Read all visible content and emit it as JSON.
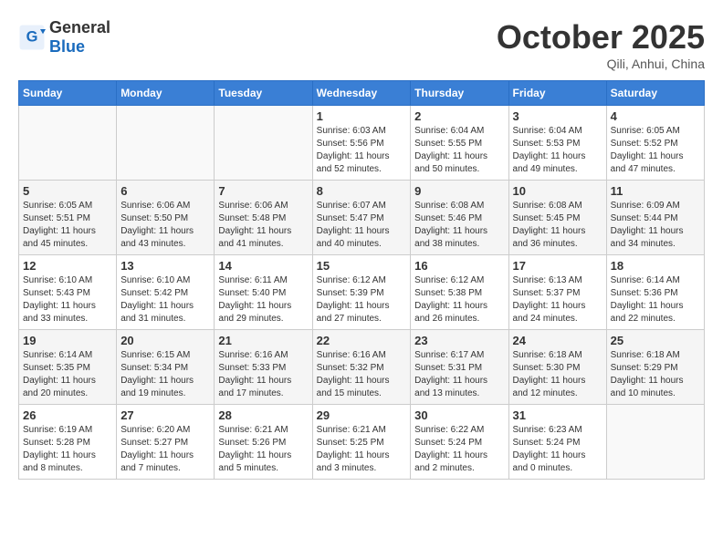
{
  "logo": {
    "general": "General",
    "blue": "Blue"
  },
  "header": {
    "month": "October 2025",
    "location": "Qili, Anhui, China"
  },
  "weekdays": [
    "Sunday",
    "Monday",
    "Tuesday",
    "Wednesday",
    "Thursday",
    "Friday",
    "Saturday"
  ],
  "weeks": [
    [
      {
        "day": "",
        "sunrise": "",
        "sunset": "",
        "daylight": ""
      },
      {
        "day": "",
        "sunrise": "",
        "sunset": "",
        "daylight": ""
      },
      {
        "day": "",
        "sunrise": "",
        "sunset": "",
        "daylight": ""
      },
      {
        "day": "1",
        "sunrise": "Sunrise: 6:03 AM",
        "sunset": "Sunset: 5:56 PM",
        "daylight": "Daylight: 11 hours and 52 minutes."
      },
      {
        "day": "2",
        "sunrise": "Sunrise: 6:04 AM",
        "sunset": "Sunset: 5:55 PM",
        "daylight": "Daylight: 11 hours and 50 minutes."
      },
      {
        "day": "3",
        "sunrise": "Sunrise: 6:04 AM",
        "sunset": "Sunset: 5:53 PM",
        "daylight": "Daylight: 11 hours and 49 minutes."
      },
      {
        "day": "4",
        "sunrise": "Sunrise: 6:05 AM",
        "sunset": "Sunset: 5:52 PM",
        "daylight": "Daylight: 11 hours and 47 minutes."
      }
    ],
    [
      {
        "day": "5",
        "sunrise": "Sunrise: 6:05 AM",
        "sunset": "Sunset: 5:51 PM",
        "daylight": "Daylight: 11 hours and 45 minutes."
      },
      {
        "day": "6",
        "sunrise": "Sunrise: 6:06 AM",
        "sunset": "Sunset: 5:50 PM",
        "daylight": "Daylight: 11 hours and 43 minutes."
      },
      {
        "day": "7",
        "sunrise": "Sunrise: 6:06 AM",
        "sunset": "Sunset: 5:48 PM",
        "daylight": "Daylight: 11 hours and 41 minutes."
      },
      {
        "day": "8",
        "sunrise": "Sunrise: 6:07 AM",
        "sunset": "Sunset: 5:47 PM",
        "daylight": "Daylight: 11 hours and 40 minutes."
      },
      {
        "day": "9",
        "sunrise": "Sunrise: 6:08 AM",
        "sunset": "Sunset: 5:46 PM",
        "daylight": "Daylight: 11 hours and 38 minutes."
      },
      {
        "day": "10",
        "sunrise": "Sunrise: 6:08 AM",
        "sunset": "Sunset: 5:45 PM",
        "daylight": "Daylight: 11 hours and 36 minutes."
      },
      {
        "day": "11",
        "sunrise": "Sunrise: 6:09 AM",
        "sunset": "Sunset: 5:44 PM",
        "daylight": "Daylight: 11 hours and 34 minutes."
      }
    ],
    [
      {
        "day": "12",
        "sunrise": "Sunrise: 6:10 AM",
        "sunset": "Sunset: 5:43 PM",
        "daylight": "Daylight: 11 hours and 33 minutes."
      },
      {
        "day": "13",
        "sunrise": "Sunrise: 6:10 AM",
        "sunset": "Sunset: 5:42 PM",
        "daylight": "Daylight: 11 hours and 31 minutes."
      },
      {
        "day": "14",
        "sunrise": "Sunrise: 6:11 AM",
        "sunset": "Sunset: 5:40 PM",
        "daylight": "Daylight: 11 hours and 29 minutes."
      },
      {
        "day": "15",
        "sunrise": "Sunrise: 6:12 AM",
        "sunset": "Sunset: 5:39 PM",
        "daylight": "Daylight: 11 hours and 27 minutes."
      },
      {
        "day": "16",
        "sunrise": "Sunrise: 6:12 AM",
        "sunset": "Sunset: 5:38 PM",
        "daylight": "Daylight: 11 hours and 26 minutes."
      },
      {
        "day": "17",
        "sunrise": "Sunrise: 6:13 AM",
        "sunset": "Sunset: 5:37 PM",
        "daylight": "Daylight: 11 hours and 24 minutes."
      },
      {
        "day": "18",
        "sunrise": "Sunrise: 6:14 AM",
        "sunset": "Sunset: 5:36 PM",
        "daylight": "Daylight: 11 hours and 22 minutes."
      }
    ],
    [
      {
        "day": "19",
        "sunrise": "Sunrise: 6:14 AM",
        "sunset": "Sunset: 5:35 PM",
        "daylight": "Daylight: 11 hours and 20 minutes."
      },
      {
        "day": "20",
        "sunrise": "Sunrise: 6:15 AM",
        "sunset": "Sunset: 5:34 PM",
        "daylight": "Daylight: 11 hours and 19 minutes."
      },
      {
        "day": "21",
        "sunrise": "Sunrise: 6:16 AM",
        "sunset": "Sunset: 5:33 PM",
        "daylight": "Daylight: 11 hours and 17 minutes."
      },
      {
        "day": "22",
        "sunrise": "Sunrise: 6:16 AM",
        "sunset": "Sunset: 5:32 PM",
        "daylight": "Daylight: 11 hours and 15 minutes."
      },
      {
        "day": "23",
        "sunrise": "Sunrise: 6:17 AM",
        "sunset": "Sunset: 5:31 PM",
        "daylight": "Daylight: 11 hours and 13 minutes."
      },
      {
        "day": "24",
        "sunrise": "Sunrise: 6:18 AM",
        "sunset": "Sunset: 5:30 PM",
        "daylight": "Daylight: 11 hours and 12 minutes."
      },
      {
        "day": "25",
        "sunrise": "Sunrise: 6:18 AM",
        "sunset": "Sunset: 5:29 PM",
        "daylight": "Daylight: 11 hours and 10 minutes."
      }
    ],
    [
      {
        "day": "26",
        "sunrise": "Sunrise: 6:19 AM",
        "sunset": "Sunset: 5:28 PM",
        "daylight": "Daylight: 11 hours and 8 minutes."
      },
      {
        "day": "27",
        "sunrise": "Sunrise: 6:20 AM",
        "sunset": "Sunset: 5:27 PM",
        "daylight": "Daylight: 11 hours and 7 minutes."
      },
      {
        "day": "28",
        "sunrise": "Sunrise: 6:21 AM",
        "sunset": "Sunset: 5:26 PM",
        "daylight": "Daylight: 11 hours and 5 minutes."
      },
      {
        "day": "29",
        "sunrise": "Sunrise: 6:21 AM",
        "sunset": "Sunset: 5:25 PM",
        "daylight": "Daylight: 11 hours and 3 minutes."
      },
      {
        "day": "30",
        "sunrise": "Sunrise: 6:22 AM",
        "sunset": "Sunset: 5:24 PM",
        "daylight": "Daylight: 11 hours and 2 minutes."
      },
      {
        "day": "31",
        "sunrise": "Sunrise: 6:23 AM",
        "sunset": "Sunset: 5:24 PM",
        "daylight": "Daylight: 11 hours and 0 minutes."
      },
      {
        "day": "",
        "sunrise": "",
        "sunset": "",
        "daylight": ""
      }
    ]
  ]
}
